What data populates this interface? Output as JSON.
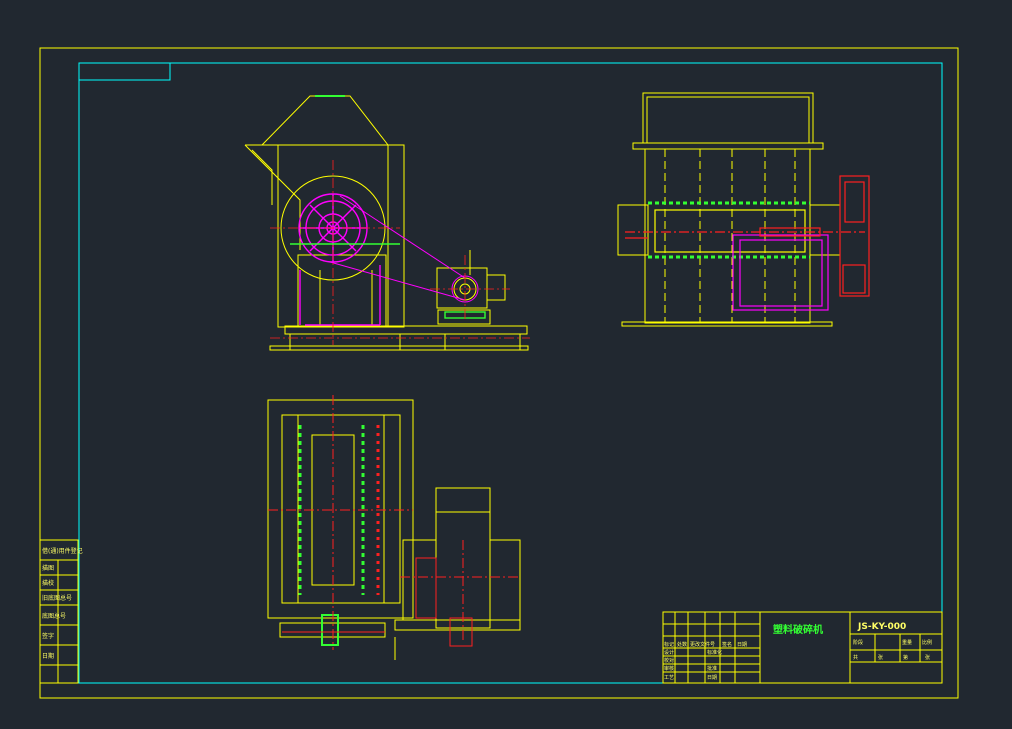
{
  "colors": {
    "background": "#212830",
    "outer_border": "#ffff00",
    "inner_border": "#00ffff",
    "yellow": "#ffff00",
    "magenta": "#ff00ff",
    "red": "#ff2020",
    "green": "#33ff33",
    "white": "#ffffff"
  },
  "title_block": {
    "drawing_name": "塑料破碎机",
    "drawing_number": "JS-KY-000",
    "headers": [
      "标记",
      "处数",
      "更改文件号",
      "签名",
      "日期"
    ],
    "roles": [
      "设计",
      "校对",
      "审核",
      "工艺"
    ],
    "small_labels": [
      "标准化",
      "批准",
      "日期"
    ],
    "right_headers": [
      "阶段",
      "重量",
      "比例"
    ],
    "right_footer": [
      "共",
      "张",
      "第",
      "张"
    ]
  },
  "side_block": {
    "rows": [
      "借(通)用件登记",
      "描图",
      "描校",
      "旧底图总号",
      "底图总号",
      "签字",
      "日期"
    ]
  }
}
